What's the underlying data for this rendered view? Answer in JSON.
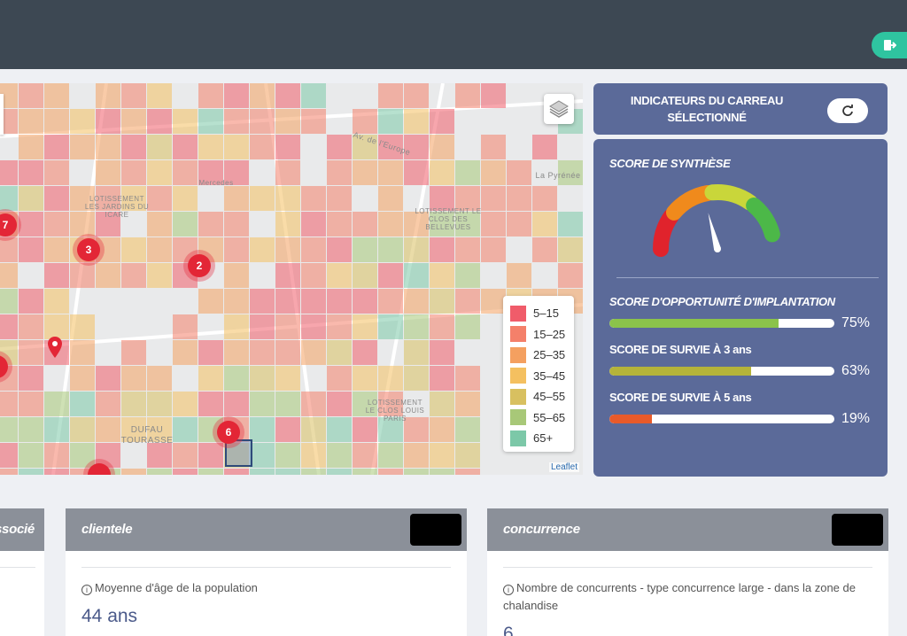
{
  "colors": {
    "topbar": "#3d4853",
    "panel": "#5b6a99",
    "accent_green": "#2fc4a0",
    "card_header": "#8b9099"
  },
  "topbar": {
    "logout_icon": "logout-icon"
  },
  "map": {
    "layers_icon": "layers-icon",
    "clusters": [
      "7",
      "3",
      "2",
      "6"
    ],
    "labels": [
      "LOTISSEMENT\nLES JARDINS DU\nICARE",
      "LOTISSEMENT LE\nCLOS DES\nBELLEVUES",
      "DUFAU\nTOURASSE",
      "LOTISSEMENT\nLE CLOS LOUIS\nPARIS",
      "La Pyrénée",
      "Av. de l'Europe",
      "Mercedes"
    ],
    "legend": [
      {
        "label": "5–15",
        "color": "#f05c6a"
      },
      {
        "label": "15–25",
        "color": "#f4806a"
      },
      {
        "label": "25–35",
        "color": "#f4a060"
      },
      {
        "label": "35–45",
        "color": "#f4c060"
      },
      {
        "label": "45–55",
        "color": "#d8c060"
      },
      {
        "label": "55–65",
        "color": "#a8c878"
      },
      {
        "label": "65+",
        "color": "#7cc8a8"
      }
    ],
    "attribution": "Leaflet"
  },
  "panel": {
    "header_title": "INDICATEURS DU CARREAU SÉLECTIONNÉ",
    "refresh_icon": "refresh-icon",
    "synthesis_title": "SCORE DE SYNTHÈSE",
    "gauge_level": 0.42,
    "scores": [
      {
        "label": "SCORE D'OPPORTUNITÉ D'IMPLANTATION",
        "value": "75%",
        "fraction": 0.75,
        "color": "#8bc34a"
      },
      {
        "label": "SCORE DE SURVIE À 3 ans",
        "value": "63%",
        "fraction": 0.63,
        "color": "#b5b43a"
      },
      {
        "label": "SCORE DE SURVIE À 5 ans",
        "value": "19%",
        "fraction": 0.19,
        "color": "#e85a2a"
      }
    ]
  },
  "cards": {
    "left_title": "ssocié",
    "clientele": {
      "title": "clientele",
      "desc": "Moyenne d'âge de la population",
      "value": "44 ans"
    },
    "concurrence": {
      "title": "concurrence",
      "desc": "Nombre de concurrents - type concurrence large - dans la zone de chalandise",
      "value": "6"
    }
  }
}
